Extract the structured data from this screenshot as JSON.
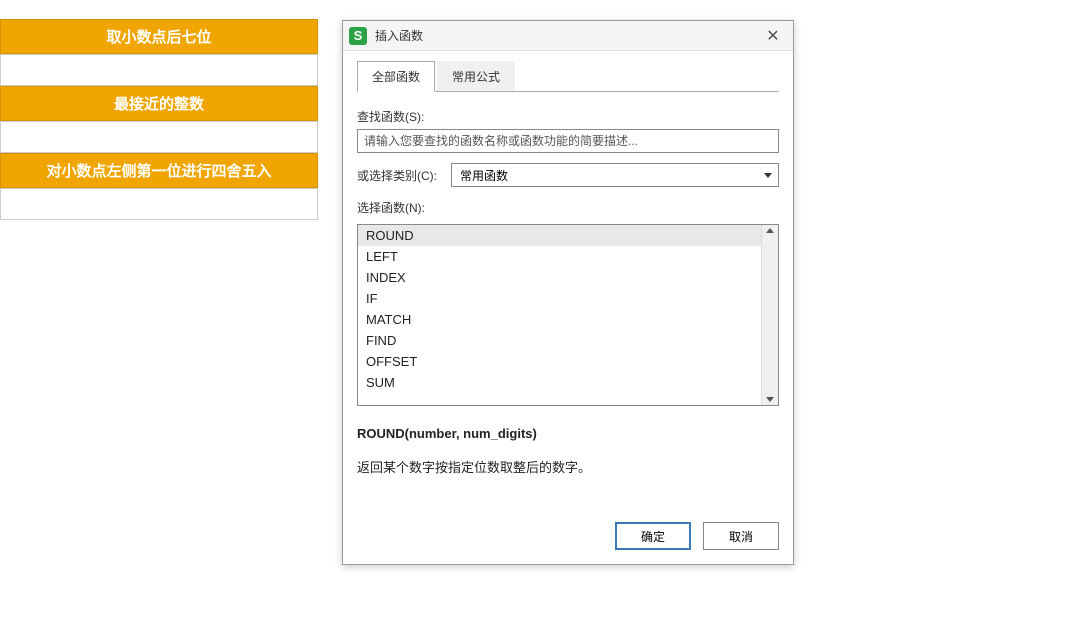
{
  "leftTable": {
    "rows": [
      {
        "type": "orange",
        "text": "取小数点后七位"
      },
      {
        "type": "white",
        "text": ""
      },
      {
        "type": "orange",
        "text": "最接近的整数"
      },
      {
        "type": "white",
        "text": ""
      },
      {
        "type": "orange",
        "text": "对小数点左侧第一位进行四舍五入"
      },
      {
        "type": "white",
        "text": ""
      }
    ]
  },
  "dialog": {
    "appIconLetter": "S",
    "title": "插入函数",
    "tabs": {
      "all": "全部函数",
      "common": "常用公式"
    },
    "searchLabel": "查找函数(S):",
    "searchPlaceholder": "请输入您要查找的函数名称或函数功能的简要描述...",
    "categoryLabel": "或选择类别(C):",
    "categoryValue": "常用函数",
    "selectLabel": "选择函数(N):",
    "functions": [
      "ROUND",
      "LEFT",
      "INDEX",
      "IF",
      "MATCH",
      "FIND",
      "OFFSET",
      "SUM"
    ],
    "selectedFunction": "ROUND",
    "signature": "ROUND(number, num_digits)",
    "description": "返回某个数字按指定位数取整后的数字。",
    "okLabel": "确定",
    "cancelLabel": "取消"
  }
}
